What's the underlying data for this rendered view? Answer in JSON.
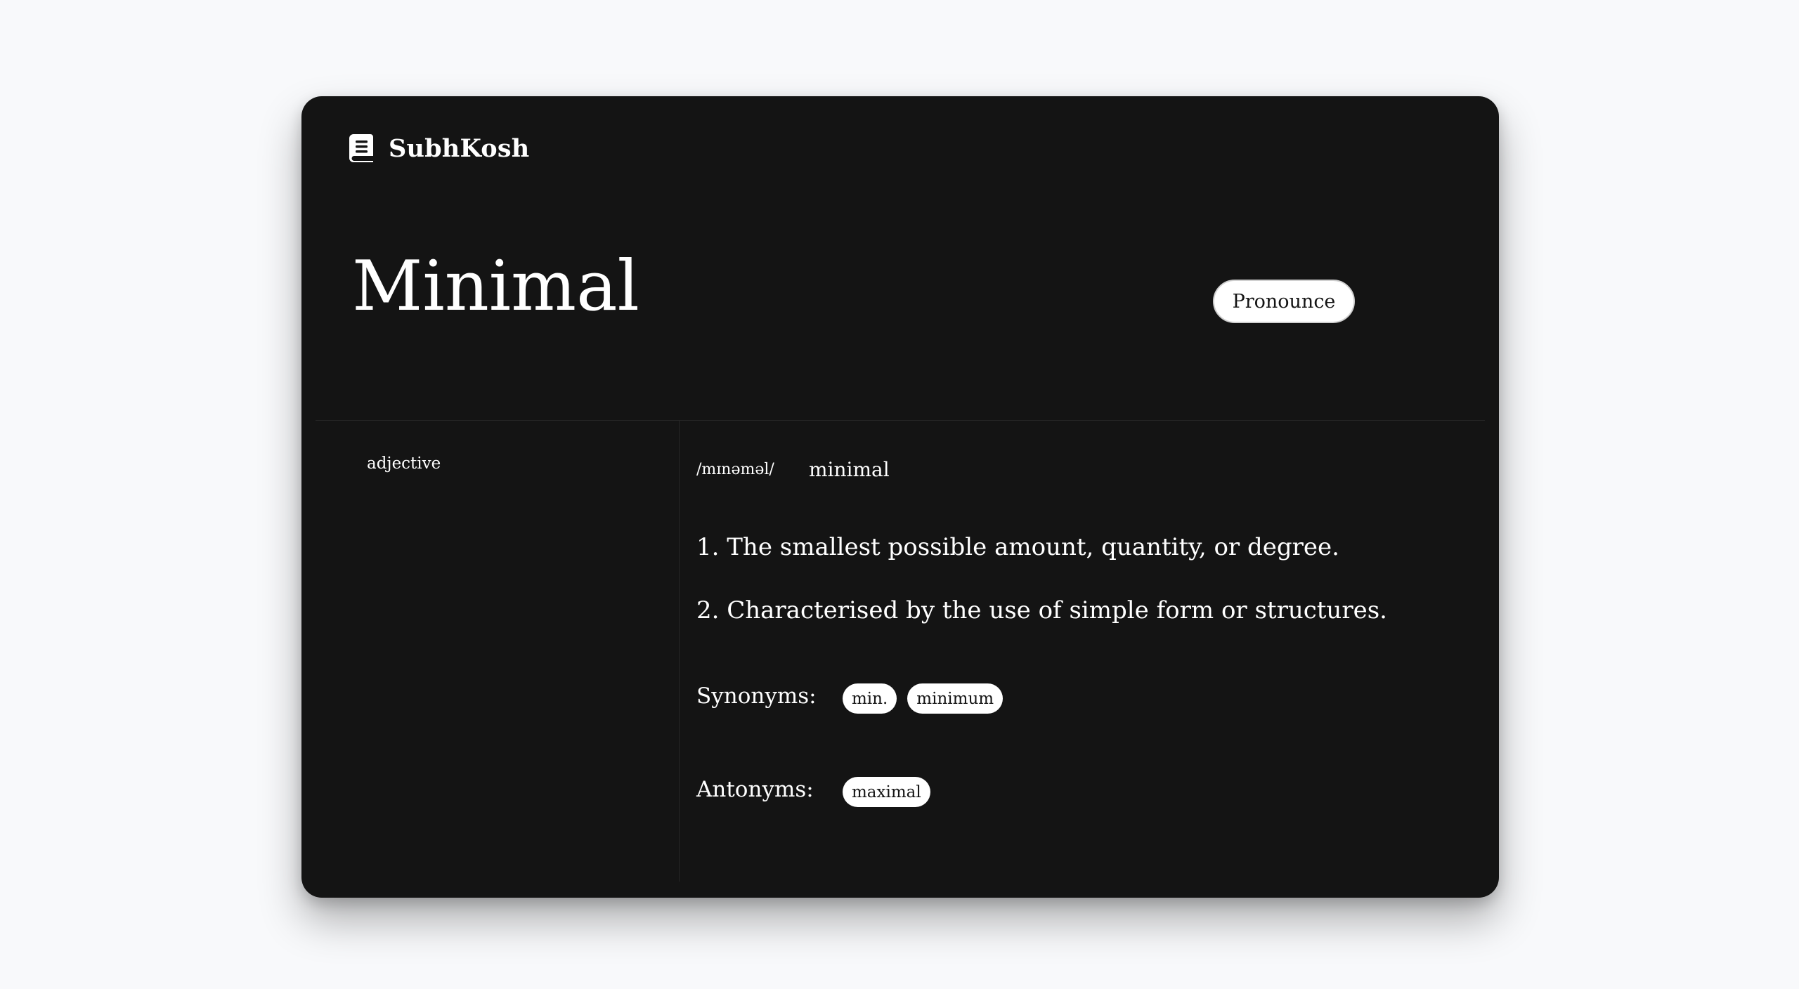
{
  "app": {
    "name": "SubhKosh",
    "logo_icon": "book-icon"
  },
  "entry": {
    "word": "Minimal",
    "pronounce_label": "Pronounce",
    "part_of_speech": "adjective",
    "phonetic": "/mɪnəməl/",
    "phonetic_word": "minimal",
    "definitions": [
      "1. The smallest possible amount, quantity, or degree.",
      "2. Characterised by the use of simple form or structures."
    ],
    "synonyms_label": "Synonyms:",
    "synonyms": [
      "min.",
      "minimum"
    ],
    "antonyms_label": "Antonyms:",
    "antonyms": [
      "maximal"
    ]
  },
  "colors": {
    "page_background": "#f8f9fb",
    "card_background": "#141414",
    "text": "#ffffff",
    "chip_background": "#ffffff",
    "chip_text": "#141414"
  }
}
